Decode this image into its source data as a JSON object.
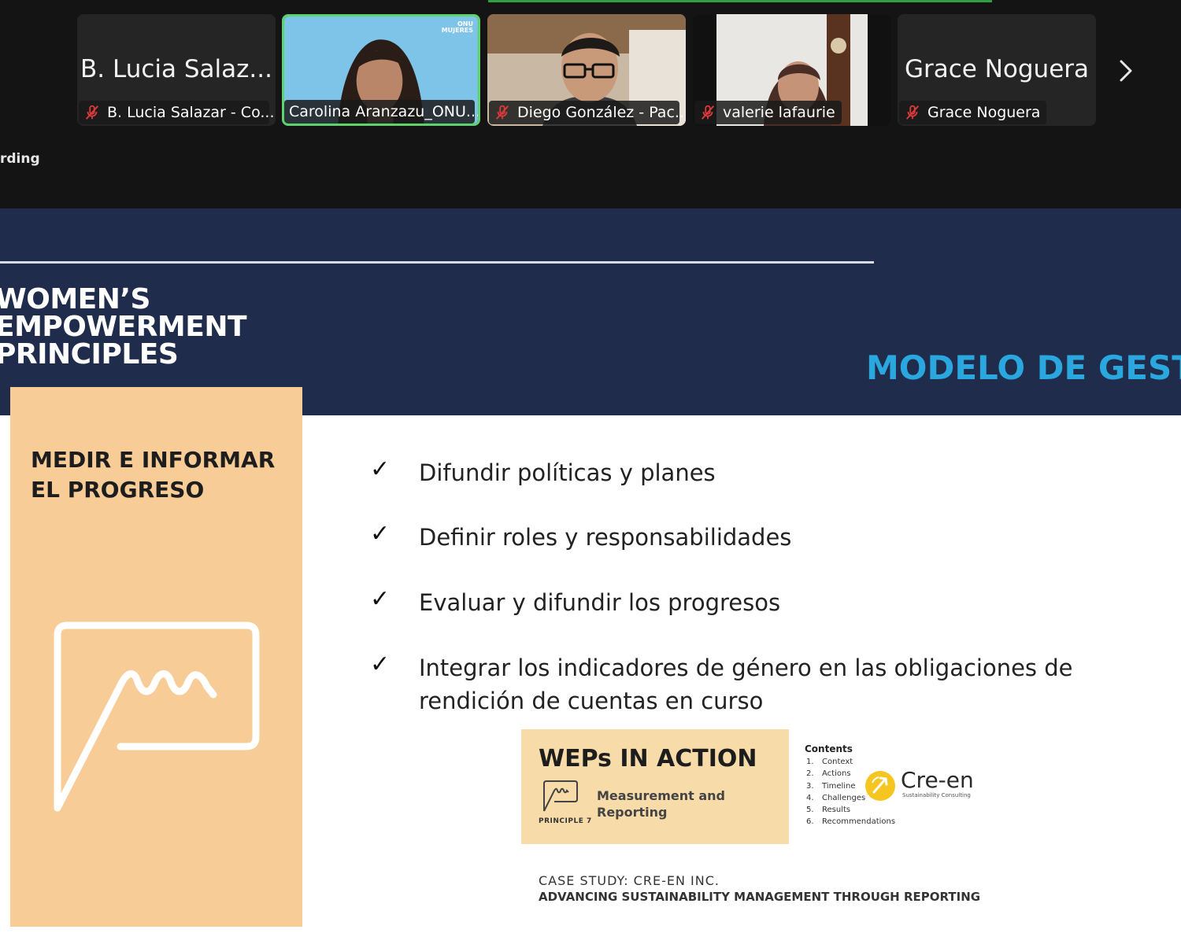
{
  "meeting": {
    "recording_label": "rding",
    "participants": [
      {
        "display_name": "B. Lucia Salaz...",
        "label": "B. Lucia Salazar - Co...",
        "muted": true,
        "video": false
      },
      {
        "label": "Carolina Aranzazu_ONU...",
        "muted": false,
        "video": true,
        "active_speaker": true,
        "logo_text": "ONU MUJERES"
      },
      {
        "label": "Diego González - Pac...",
        "muted": true,
        "video": true
      },
      {
        "label": "valerie lafaurie",
        "muted": true,
        "video": true
      },
      {
        "display_name": "Grace Noguera",
        "label": "Grace Noguera",
        "muted": true,
        "video": false
      }
    ],
    "next_page_icon": "chevron-right-icon",
    "active_speaker_color": "#5fd36b",
    "mute_icon_color": "#e03a3a"
  },
  "slide": {
    "weps_title_lines": [
      "WOMEN’S",
      "EMPOWERMENT",
      "PRINCIPLES"
    ],
    "heading": "MODELO DE GESTI",
    "principle_title_lines": [
      "MEDIR E INFORMAR",
      "EL PROGRESO"
    ],
    "principle_icon": "chart-measure-icon",
    "bullets": [
      "Difundir políticas y planes",
      "Definir roles y responsabilidades",
      "Evaluar y difundir los progresos",
      "Integrar los indicadores de género en las obligaciones de rendición de cuentas en curso"
    ],
    "check_mark": "✓",
    "weps_card": {
      "title": "WEPs IN ACTION",
      "measure_lines": [
        "Measurement and",
        "Reporting"
      ],
      "principle_label": "PRINCIPLE 7",
      "contents_title": "Contents",
      "contents": [
        "Context",
        "Actions",
        "Timeline",
        "Challenges",
        "Results",
        "Recommendations"
      ],
      "brand": "Cre-en",
      "brand_sub": "Sustainability Consulting"
    },
    "case_study_line1": "CASE STUDY: CRE-EN INC.",
    "case_study_line2": "ADVANCING SUSTAINABILITY MANAGEMENT THROUGH REPORTING",
    "colors": {
      "navy": "#1f2c4b",
      "accent_blue": "#2aa7df",
      "principle_orange": "#f7cc96"
    }
  }
}
